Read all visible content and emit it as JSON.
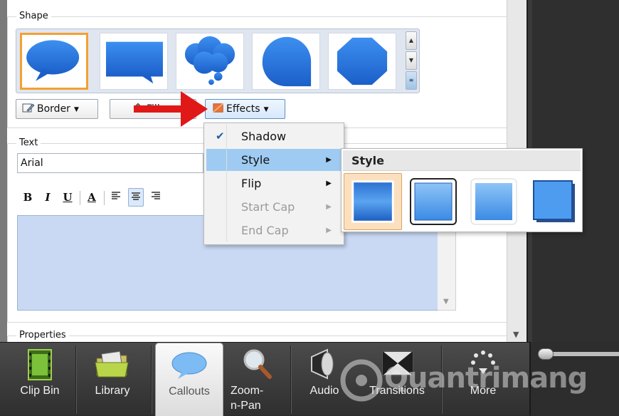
{
  "shape_section": {
    "legend": "Shape",
    "buttons": {
      "border": "Border",
      "fill": "Fill",
      "effects": "Effects"
    }
  },
  "text_section": {
    "legend": "Text",
    "font": "Arial",
    "format": {
      "bold": "B",
      "italic": "I",
      "underline": "U",
      "font_color": "A"
    }
  },
  "properties_section": {
    "legend": "Properties"
  },
  "effects_menu": {
    "items": [
      {
        "label": "Shadow",
        "checked": true,
        "enabled": true,
        "submenu": false
      },
      {
        "label": "Style",
        "checked": false,
        "enabled": true,
        "submenu": true,
        "highlighted": true
      },
      {
        "label": "Flip",
        "checked": false,
        "enabled": true,
        "submenu": true
      },
      {
        "label": "Start Cap",
        "checked": false,
        "enabled": false,
        "submenu": true
      },
      {
        "label": "End Cap",
        "checked": false,
        "enabled": false,
        "submenu": true
      }
    ]
  },
  "style_submenu": {
    "title": "Style",
    "selected_index": 0
  },
  "bottom_tabs": [
    {
      "label": "Clip Bin",
      "icon": "film-strip-icon"
    },
    {
      "label": "Library",
      "icon": "library-folder-icon"
    },
    {
      "label": "Callouts",
      "icon": "speech-bubble-icon",
      "active": true
    },
    {
      "label": "Zoom-n-Pan",
      "icon": "magnifier-icon"
    },
    {
      "label": "Audio",
      "icon": "speaker-icon"
    },
    {
      "label": "Transitions",
      "icon": "transitions-icon"
    },
    {
      "label": "More",
      "icon": "more-dots-icon"
    }
  ],
  "watermark": {
    "text": "Quantrimang"
  },
  "colors": {
    "selection_orange": "#f4a030",
    "menu_highlight": "#9fcbf2",
    "shape_blue": "#1f6fd6",
    "text_area": "#c9d9f4"
  }
}
